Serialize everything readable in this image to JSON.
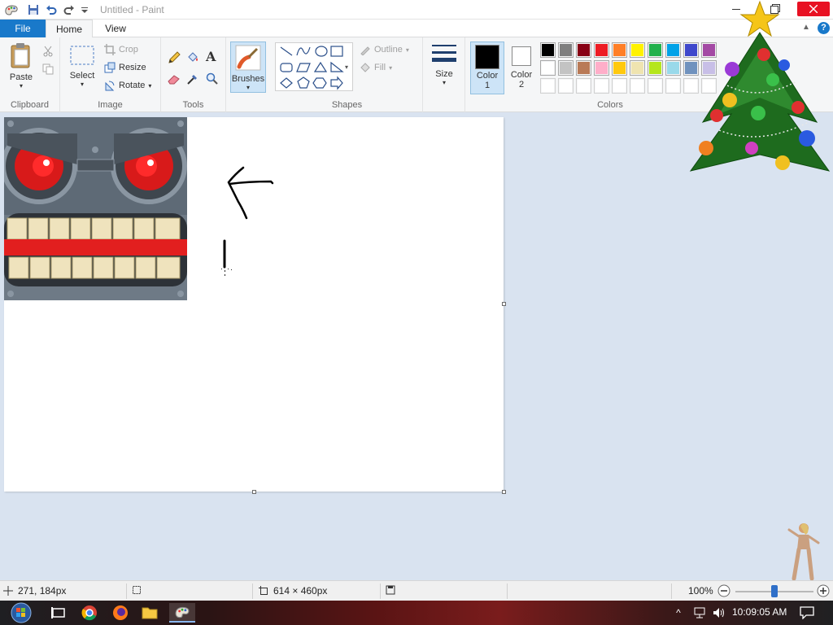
{
  "window": {
    "title": "Untitled - Paint"
  },
  "tabs": {
    "file": "File",
    "home": "Home",
    "view": "View"
  },
  "ribbon": {
    "clipboard": {
      "label": "Clipboard",
      "paste": "Paste"
    },
    "image": {
      "label": "Image",
      "select": "Select",
      "crop": "Crop",
      "resize": "Resize",
      "rotate": "Rotate"
    },
    "tools": {
      "label": "Tools"
    },
    "brushes": {
      "label": "Brushes"
    },
    "shapes": {
      "label": "Shapes",
      "outline": "Outline",
      "fill": "Fill"
    },
    "size": {
      "label": "Size"
    },
    "colors": {
      "label": "Colors",
      "color1_label": "Color",
      "color1_num": "1",
      "color2_label": "Color",
      "color2_num": "2",
      "color1": "#000000",
      "color2": "#ffffff",
      "palette_row1": [
        "#000000",
        "#7f7f7f",
        "#880015",
        "#ed1c24",
        "#ff7f27",
        "#fff200",
        "#22b14c",
        "#00a2e8",
        "#3f48cc",
        "#a349a4"
      ],
      "palette_row2": [
        "#ffffff",
        "#c3c3c3",
        "#b97a57",
        "#ffaec9",
        "#ffc90e",
        "#efe4b0",
        "#b5e61d",
        "#99d9ea",
        "#7092be",
        "#c8bfe7"
      ],
      "palette_row3": [
        "#ffffff",
        "#ffffff",
        "#ffffff",
        "#ffffff",
        "#ffffff",
        "#ffffff",
        "#ffffff",
        "#ffffff",
        "#ffffff",
        "#ffffff"
      ]
    }
  },
  "status": {
    "cursor_pos": "271, 184px",
    "image_size": "614 × 460px",
    "zoom": "100%",
    "zoom_level": 0.5
  },
  "taskbar": {
    "time": "10:09:05 AM"
  },
  "icons": {
    "paste": "clipboard-icon",
    "cut": "scissors-icon",
    "copy": "copy-icon",
    "pencil": "pencil-icon",
    "fill": "bucket-icon",
    "text": "text-icon",
    "eraser": "eraser-icon",
    "picker": "eyedropper-icon",
    "magnifier": "magnifier-icon"
  }
}
